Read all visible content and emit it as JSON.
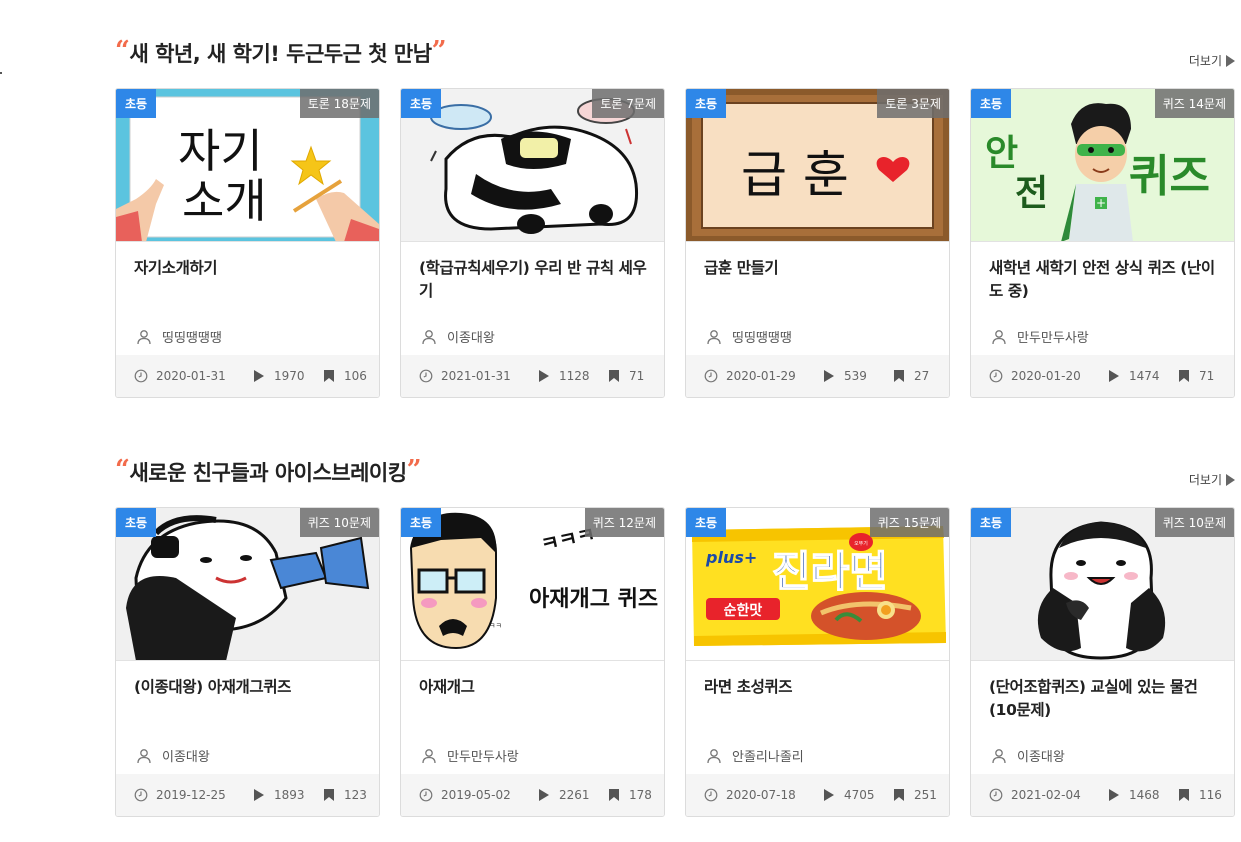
{
  "sections": [
    {
      "title": "새 학년, 새 학기! 두근두근 첫 만남",
      "more_label": "더보기",
      "cards": [
        {
          "grade": "초등",
          "type": "토론 18문제",
          "title": "자기소개하기",
          "author": "띵띵땡땡땡",
          "date": "2020-01-31",
          "views": "1970",
          "saves": "106",
          "image": {
            "line1": "자기",
            "line2": "소개"
          }
        },
        {
          "grade": "초등",
          "type": "토론 7문제",
          "title": "(학급규칙세우기) 우리 반 규칙 세우기",
          "author": "이종대왕",
          "date": "2021-01-31",
          "views": "1128",
          "saves": "71"
        },
        {
          "grade": "초등",
          "type": "토론 3문제",
          "title": "급훈 만들기",
          "author": "띵띵땡땡땡",
          "date": "2020-01-29",
          "views": "539",
          "saves": "27",
          "image": {
            "text": "급 훈"
          }
        },
        {
          "grade": "초등",
          "type": "퀴즈 14문제",
          "title": "새학년 새학기 안전 상식 퀴즈 (난이도 중)",
          "author": "만두만두사랑",
          "date": "2020-01-20",
          "views": "1474",
          "saves": "71",
          "image": {
            "left_top": "안",
            "left_bottom": "전",
            "right": "퀴즈"
          }
        }
      ]
    },
    {
      "title": "새로운 친구들과 아이스브레이킹",
      "more_label": "더보기",
      "cards": [
        {
          "grade": "초등",
          "type": "퀴즈 10문제",
          "title": "(이종대왕) 아재개그퀴즈",
          "author": "이종대왕",
          "date": "2019-12-25",
          "views": "1893",
          "saves": "123"
        },
        {
          "grade": "초등",
          "type": "퀴즈 12문제",
          "title": "아재개그",
          "author": "만두만두사랑",
          "date": "2019-05-02",
          "views": "2261",
          "saves": "178",
          "image": {
            "laugh": "ㅋㅋㅋ",
            "caption": "아재개그 퀴즈",
            "small": "ㅋㅋ"
          }
        },
        {
          "grade": "초등",
          "type": "퀴즈 15문제",
          "title": "라면 초성퀴즈",
          "author": "안졸리나졸리",
          "date": "2020-07-18",
          "views": "4705",
          "saves": "251",
          "image": {
            "plus": "plus+",
            "brand": "진라면",
            "flavor": "순한맛",
            "ottogi": "오뚜기"
          }
        },
        {
          "grade": "초등",
          "type": "퀴즈 10문제",
          "title": "(단어조합퀴즈) 교실에 있는 물건(10문제)",
          "author": "이종대왕",
          "date": "2021-02-04",
          "views": "1468",
          "saves": "116"
        }
      ]
    }
  ],
  "colors": {
    "accent_quote": "#f26b4b",
    "grade_badge": "#2e87e8",
    "type_badge": "#6e6e6e"
  },
  "icons": [
    "user-icon",
    "clock-icon",
    "play-icon",
    "bookmark-icon",
    "chevron-right-icon"
  ]
}
